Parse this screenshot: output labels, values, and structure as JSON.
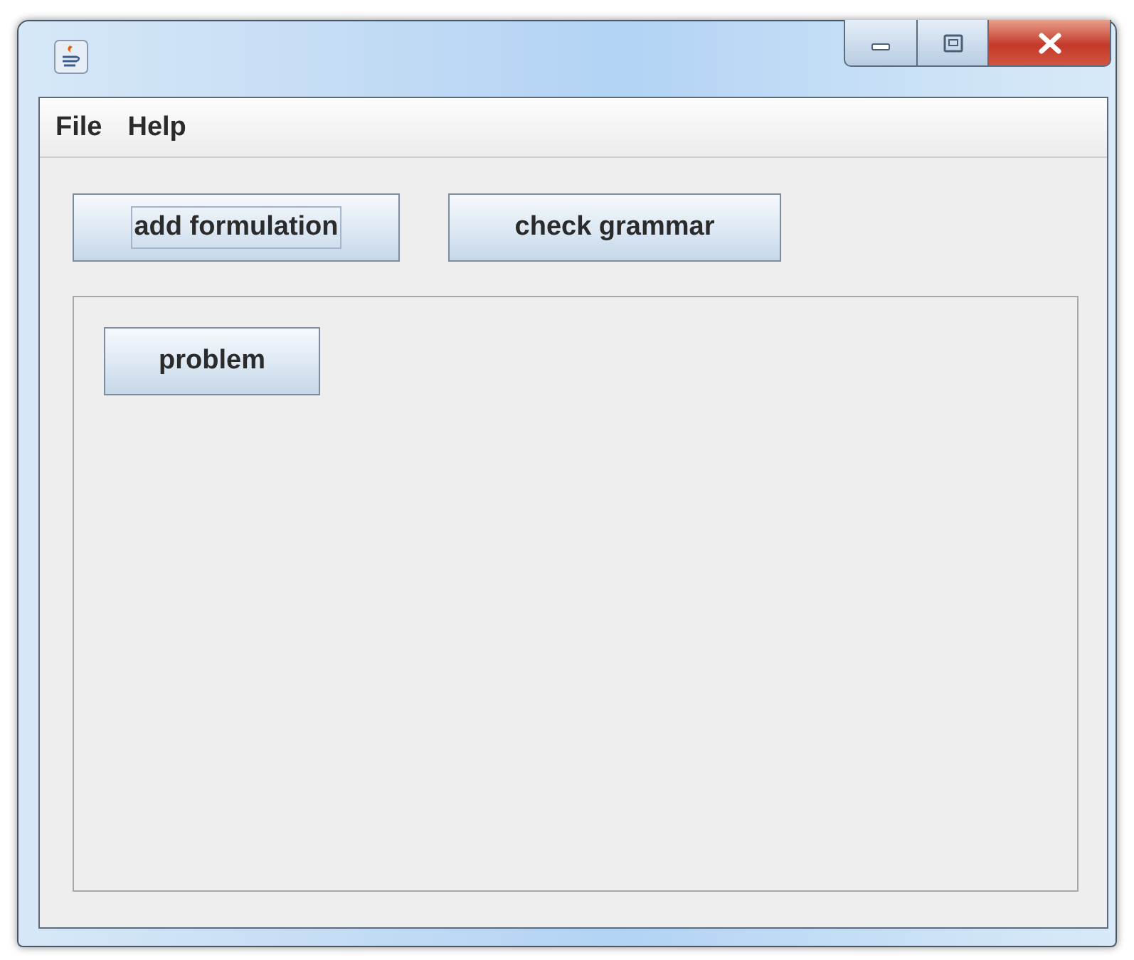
{
  "window": {
    "controls": [
      {
        "kind": "minimize"
      },
      {
        "kind": "maximize"
      },
      {
        "kind": "close"
      }
    ]
  },
  "menu": [
    {
      "label": "File"
    },
    {
      "label": "Help"
    }
  ],
  "toolbar": [
    {
      "label": "add formulation",
      "focused": true
    },
    {
      "label": "check grammar",
      "focused": false
    }
  ],
  "panel": {
    "buttons": [
      {
        "label": "problem",
        "focused": false
      }
    ]
  }
}
